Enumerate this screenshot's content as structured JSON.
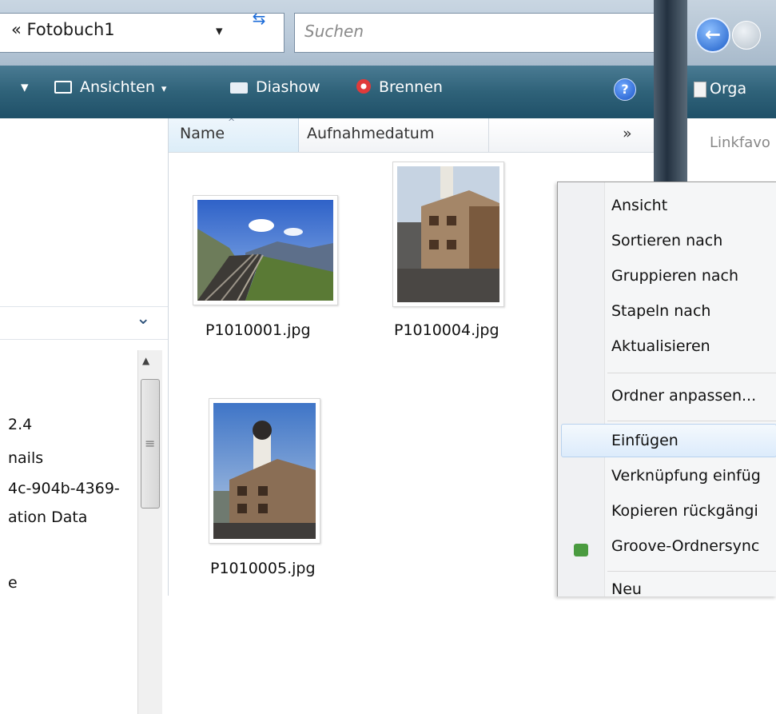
{
  "address_bar": {
    "path_prefix": "«",
    "path": "Fotobuch1",
    "search_placeholder": "Suchen"
  },
  "toolbar": {
    "views_label": "Ansichten",
    "slideshow_label": "Diashow",
    "burn_label": "Brennen",
    "help_label": "?"
  },
  "columns": {
    "name": "Name",
    "date_taken": "Aufnahmedatum",
    "more": "»"
  },
  "nav_pane": {
    "items": [
      "2.4",
      "nails",
      "4c-904b-4369-",
      "ation Data",
      "e"
    ]
  },
  "files": [
    {
      "name": "P1010001.jpg"
    },
    {
      "name": "P1010004.jpg"
    },
    {
      "name": "P1010005.jpg"
    }
  ],
  "right_window": {
    "organize_label": "Orga",
    "links_label": "Linkfavo"
  },
  "context_menu": {
    "items": [
      "Ansicht",
      "Sortieren nach",
      "Gruppieren nach",
      "Stapeln nach",
      "Aktualisieren",
      "Ordner anpassen...",
      "Einfügen",
      "Verknüpfung einfüg",
      "Kopieren rückgängi",
      "Groove-Ordnersync",
      "Neu"
    ],
    "highlighted": "Einfügen"
  }
}
